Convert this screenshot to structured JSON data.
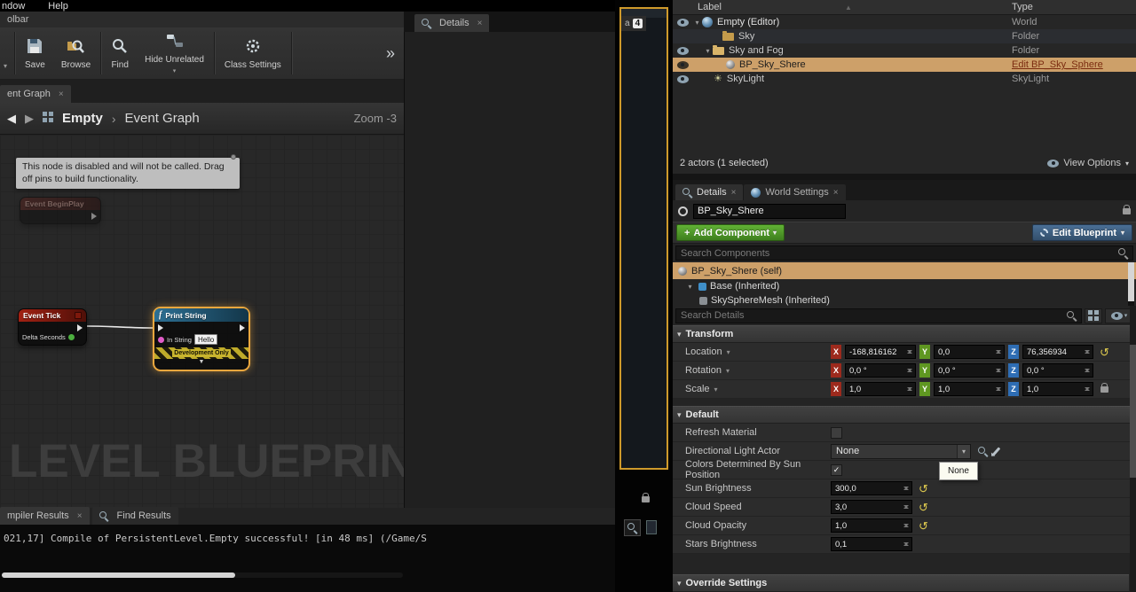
{
  "icons": {
    "close": "×",
    "caret": "▾",
    "back": "◀",
    "forward": "▶",
    "overflow": "»",
    "crumb_sep": "›",
    "sort": "▲",
    "reset": "↺",
    "check": "✓",
    "axis_x": "X",
    "axis_y": "Y",
    "axis_z": "Z",
    "fn": "f",
    "sun": "☀",
    "expand": "▼",
    "plus": "+"
  },
  "menubar": {
    "window": "ndow",
    "help": "Help"
  },
  "toolbar": {
    "caption": "olbar",
    "save": "Save",
    "browse": "Browse",
    "find": "Find",
    "hide_unrelated": "Hide Unrelated",
    "class_settings": "Class Settings"
  },
  "tabs": {
    "event_graph": "ent Graph",
    "details_float": "Details"
  },
  "breadcrumb": {
    "root": "Empty",
    "current": "Event Graph",
    "zoom": "Zoom -3"
  },
  "graph": {
    "note": "This node is disabled and will not be called. Drag off pins to build functionality.",
    "begin_play": "Event BeginPlay",
    "event_tick": "Event Tick",
    "delta_seconds": "Delta Seconds",
    "print_string": "Print String",
    "in_string": "In String",
    "in_string_value": "Hello",
    "dev_only": "Development Only",
    "watermark": "LEVEL BLUEPRINT"
  },
  "bottom": {
    "compiler_tab": "mpiler Results",
    "find_tab": "Find Results",
    "log": "021,17] Compile of PersistentLevel.Empty successful! [in 48 ms] (/Game/S"
  },
  "middle": {
    "tab": "a",
    "badge": "4"
  },
  "outliner": {
    "col_label": "Label",
    "col_type": "Type",
    "rows": [
      {
        "label": "Empty (Editor)",
        "type": "World"
      },
      {
        "label": "Sky",
        "type": "Folder"
      },
      {
        "label": "Sky and Fog",
        "type": "Folder"
      },
      {
        "label": "BP_Sky_Shere",
        "type": "Edit BP_Sky_Sphere"
      },
      {
        "label": "SkyLight",
        "type": "SkyLight"
      }
    ],
    "footer": "2 actors (1 selected)",
    "view_options": "View Options"
  },
  "details": {
    "tab_details": "Details",
    "tab_world": "World Settings",
    "name_value": "BP_Sky_Shere",
    "add_component": "Add Component",
    "edit_blueprint": "Edit Blueprint",
    "search_components": "Search Components",
    "search_details": "Search Details",
    "comp_self": "BP_Sky_Shere (self)",
    "comp_base": "Base (Inherited)",
    "comp_mesh": "SkySphereMesh (Inherited)",
    "transform": {
      "title": "Transform",
      "location": {
        "label": "Location",
        "x": "-168,816162",
        "y": "0,0",
        "z": "76,356934"
      },
      "rotation": {
        "label": "Rotation",
        "x": "0,0 °",
        "y": "0,0 °",
        "z": "0,0 °"
      },
      "scale": {
        "label": "Scale",
        "x": "1,0",
        "y": "1,0",
        "z": "1,0"
      }
    },
    "default": {
      "title": "Default",
      "refresh_material": "Refresh Material",
      "directional_light_actor": "Directional Light Actor",
      "dla_value": "None",
      "colors_sun": "Colors Determined By Sun Position",
      "sun_brightness": "Sun Brightness",
      "sun_value": "300,0",
      "cloud_speed": "Cloud Speed",
      "cloud_speed_value": "3,0",
      "cloud_opacity": "Cloud Opacity",
      "cloud_opacity_value": "1,0",
      "stars_brightness": "Stars Brightness",
      "stars_value": "0,1"
    },
    "override_title": "Override Settings",
    "tooltip": "None"
  }
}
